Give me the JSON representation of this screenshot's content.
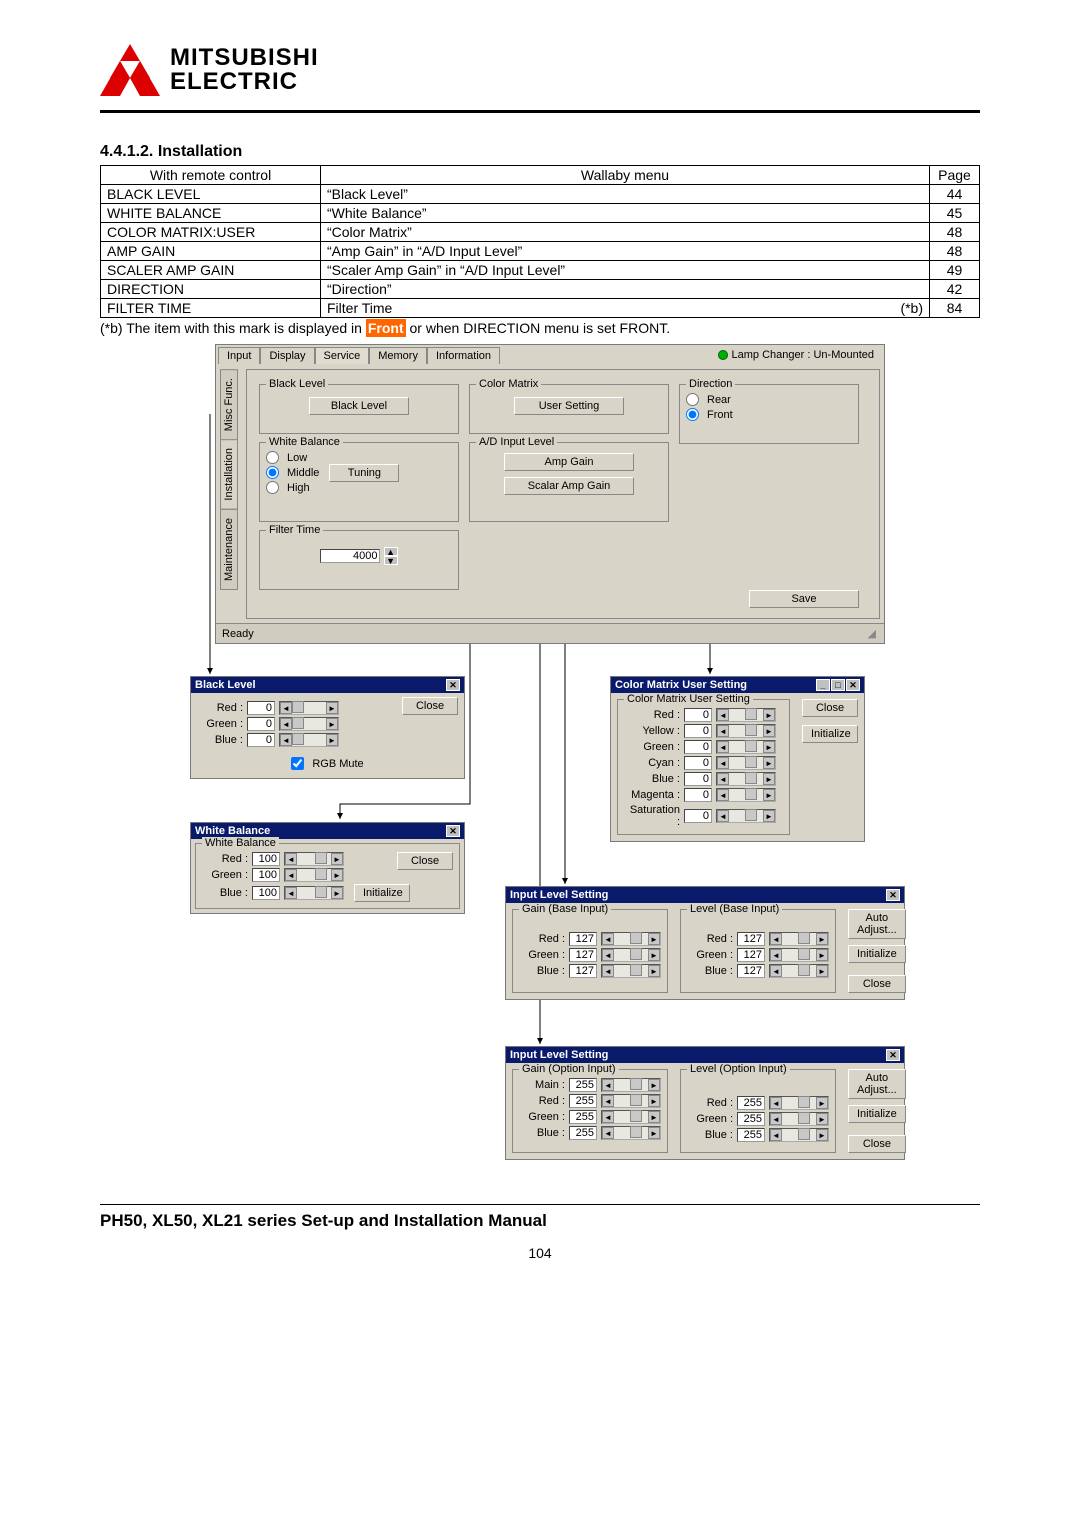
{
  "header": {
    "brand1": "MITSUBISHI",
    "brand2": "ELECTRIC"
  },
  "section": {
    "num": "4.4.1.2.",
    "title": "Installation"
  },
  "table": {
    "head": {
      "c1": "With remote control",
      "c2": "Wallaby menu",
      "c3": "Page"
    },
    "rows": [
      {
        "c1": "BLACK LEVEL",
        "c2": "“Black Level”",
        "c3": "44"
      },
      {
        "c1": "WHITE BALANCE",
        "c2": "“White Balance”",
        "c3": "45"
      },
      {
        "c1": "COLOR MATRIX:USER",
        "c2": "“Color Matrix”",
        "c3": "48"
      },
      {
        "c1": "AMP GAIN",
        "c2": "“Amp Gain” in “A/D Input Level”",
        "c3": "48"
      },
      {
        "c1": "SCALER AMP GAIN",
        "c2": "“Scaler Amp Gain” in “A/D Input Level”",
        "c3": "49"
      },
      {
        "c1": "DIRECTION",
        "c2": "“Direction”",
        "c3": "42"
      },
      {
        "c1": "FILTER TIME",
        "c2": "Filter Time",
        "c2b": "(*b)",
        "c3": "84"
      }
    ]
  },
  "note": {
    "pre": "(*b) The item with this mark is displayed in ",
    "tag": "Front",
    "post": " or when DIRECTION menu is set FRONT."
  },
  "main_win": {
    "tabs_top": [
      "Input",
      "Display",
      "Service",
      "Memory",
      "Information"
    ],
    "vtabs": [
      "Maintenance",
      "Installation",
      "Misc Func."
    ],
    "lamp": "Lamp Changer :   Un-Mounted",
    "black_level": {
      "legend": "Black Level",
      "btn": "Black Level"
    },
    "white_balance": {
      "legend": "White Balance",
      "low": "Low",
      "middle": "Middle",
      "high": "High",
      "btn": "Tuning"
    },
    "filter_time": {
      "legend": "Filter Time",
      "val": "4000"
    },
    "color_matrix": {
      "legend": "Color Matrix",
      "btn": "User Setting"
    },
    "ad": {
      "legend": "A/D Input Level",
      "btn1": "Amp Gain",
      "btn2": "Scalar Amp Gain"
    },
    "direction": {
      "legend": "Direction",
      "rear": "Rear",
      "front": "Front"
    },
    "save": "Save",
    "status": "Ready"
  },
  "blacklevel_dlg": {
    "title": "Black Level",
    "red": "Red :",
    "green": "Green :",
    "blue": "Blue :",
    "v": "0",
    "close": "Close",
    "mute": "RGB Mute"
  },
  "wb_dlg": {
    "title": "White Balance",
    "legend": "White Balance",
    "red": "Red :",
    "green": "Green :",
    "blue": "Blue :",
    "v": "100",
    "close": "Close",
    "init": "Initialize"
  },
  "cm_dlg": {
    "title": "Color Matrix User Setting",
    "legend": "Color Matrix User Setting",
    "red": "Red :",
    "yellow": "Yellow :",
    "green": "Green :",
    "cyan": "Cyan :",
    "blue": "Blue :",
    "magenta": "Magenta :",
    "sat": "Saturation :",
    "v": "0",
    "close": "Close",
    "init": "Initialize"
  },
  "il1_dlg": {
    "title": "Input Level Setting",
    "gain_leg": "Gain (Base Input)",
    "level_leg": "Level (Base Input)",
    "red": "Red :",
    "green": "Green :",
    "blue": "Blue :",
    "v": "127",
    "auto": "Auto Adjust...",
    "init": "Initialize",
    "close": "Close"
  },
  "il2_dlg": {
    "title": "Input Level Setting",
    "gain_leg": "Gain (Option Input)",
    "level_leg": "Level (Option Input)",
    "main": "Main :",
    "red": "Red :",
    "green": "Green :",
    "blue": "Blue :",
    "v": "255",
    "auto": "Auto Adjust...",
    "init": "Initialize",
    "close": "Close"
  },
  "footer": "PH50, XL50, XL21 series Set-up and Installation Manual",
  "pagenum": "104"
}
